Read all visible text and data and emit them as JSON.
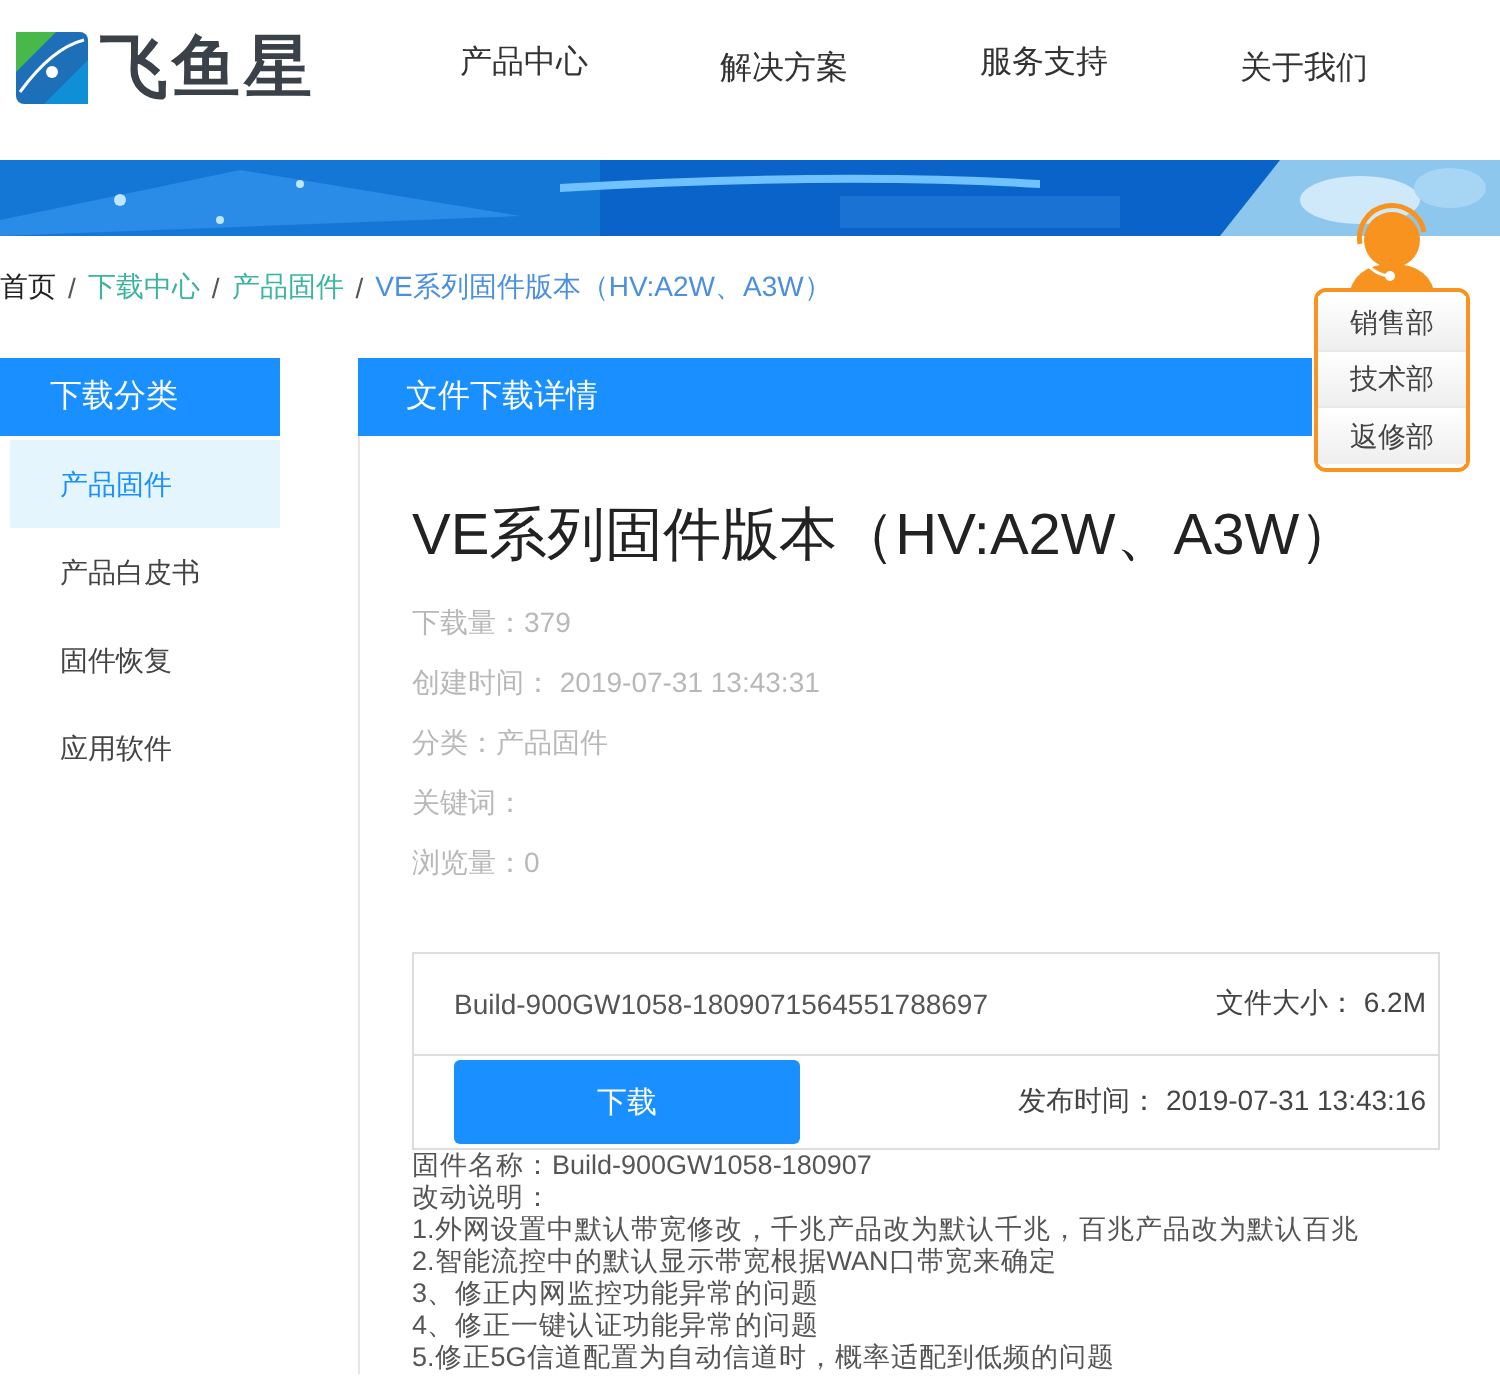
{
  "logo": {
    "text": "飞鱼星"
  },
  "nav": [
    {
      "label": "产品中心"
    },
    {
      "label": "解决方案"
    },
    {
      "label": "服务支持"
    },
    {
      "label": "关于我们"
    }
  ],
  "breadcrumb": [
    {
      "label": "首页",
      "kind": "home"
    },
    {
      "separator": "/",
      "label": "下载中心",
      "kind": "link"
    },
    {
      "separator": "/",
      "label": "产品固件",
      "kind": "link"
    },
    {
      "separator": "/",
      "label": "VE系列固件版本（HV:A2W、A3W）",
      "kind": "current"
    }
  ],
  "support": {
    "items": [
      {
        "label": "销售部"
      },
      {
        "label": "技术部"
      },
      {
        "label": "返修部"
      }
    ]
  },
  "sidebar": {
    "title": "下载分类",
    "items": [
      {
        "label": "产品固件",
        "selected": true
      },
      {
        "label": "产品白皮书",
        "selected": false
      },
      {
        "label": "固件恢复",
        "selected": false
      },
      {
        "label": "应用软件",
        "selected": false
      }
    ]
  },
  "main": {
    "header": "文件下载详情",
    "title": "VE系列固件版本（HV:A2W、A3W）",
    "details": [
      "下载量：379",
      "创建时间： 2019-07-31 13:43:31",
      "分类：产品固件",
      "关键词：",
      "浏览量：0"
    ],
    "file": {
      "name": "Build-900GW1058-1809071564551788697",
      "size": "文件大小： 6.2M",
      "button": "下载",
      "released": "发布时间： 2019-07-31 13:43:16"
    },
    "notes": [
      "固件名称：Build-900GW1058-180907",
      "改动说明：",
      "1.外网设置中默认带宽修改，千兆产品改为默认千兆，百兆产品改为默认百兆",
      "2.智能流控中的默认显示带宽根据WAN口带宽来确定",
      "3、修正内网监控功能异常的问题",
      "4、修正一键认证功能异常的问题",
      "5.修正5G信道配置为自动信道时，概率适配到低频的问题"
    ]
  }
}
